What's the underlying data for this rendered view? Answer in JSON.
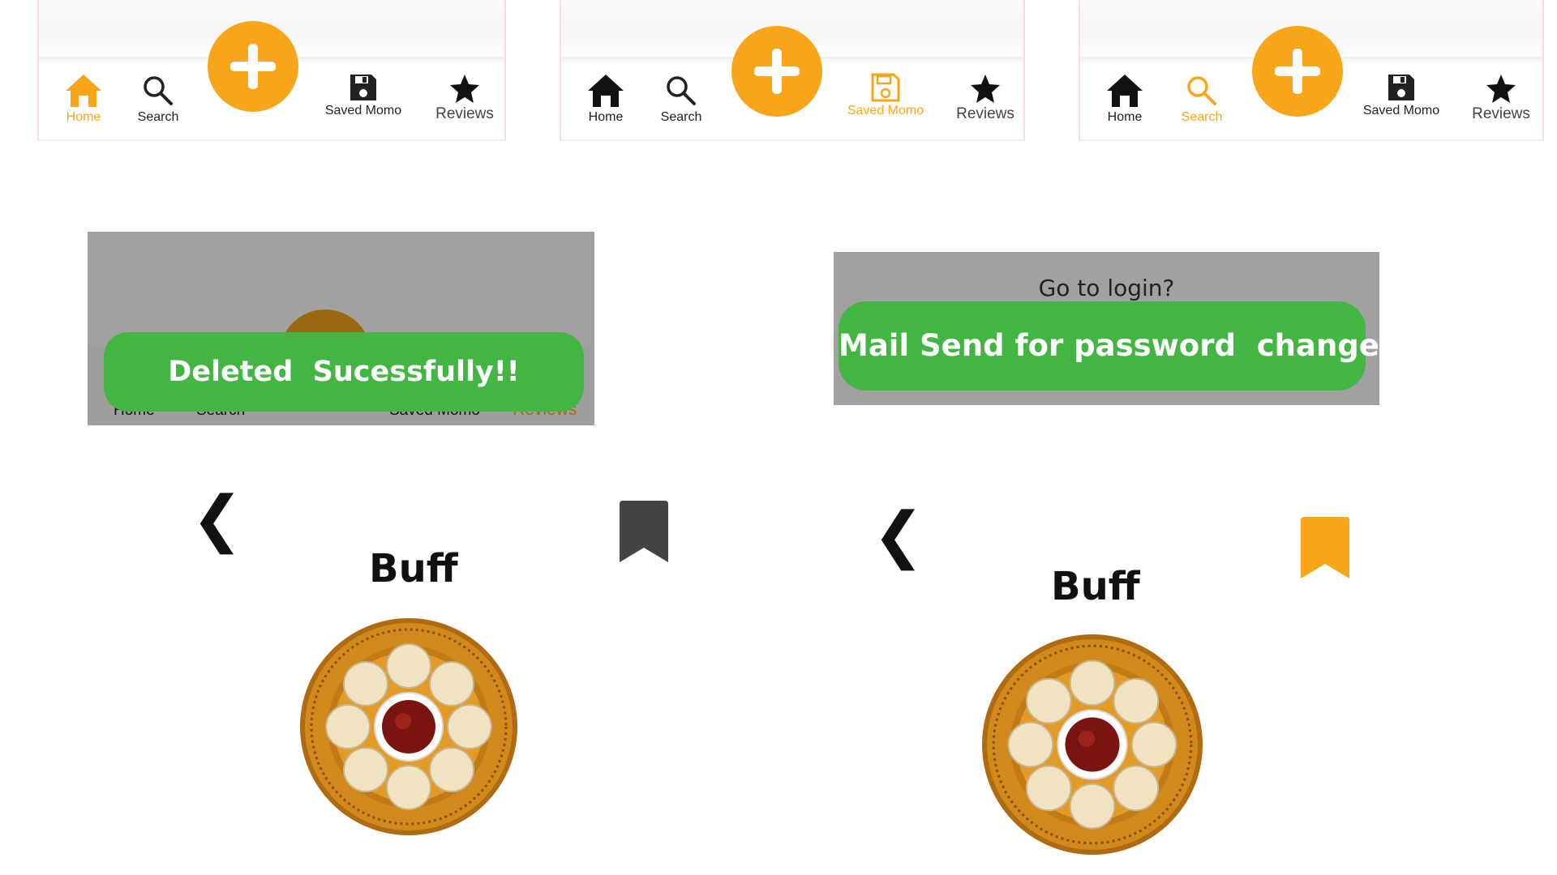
{
  "tab_bars": [
    {
      "active": "home",
      "tabs": [
        {
          "id": "home",
          "label": "Home"
        },
        {
          "id": "search",
          "label": "Search"
        },
        {
          "id": "saved",
          "label": "Saved Momo"
        },
        {
          "id": "reviews",
          "label": "Reviews"
        }
      ]
    },
    {
      "active": "saved",
      "tabs": [
        {
          "id": "home",
          "label": "Home"
        },
        {
          "id": "search",
          "label": "Search"
        },
        {
          "id": "saved",
          "label": "Saved Momo"
        },
        {
          "id": "reviews",
          "label": "Reviews"
        }
      ]
    },
    {
      "active": "search",
      "tabs": [
        {
          "id": "home",
          "label": "Home"
        },
        {
          "id": "search",
          "label": "Search"
        },
        {
          "id": "saved",
          "label": "Saved Momo"
        },
        {
          "id": "reviews",
          "label": "Reviews"
        }
      ]
    }
  ],
  "toasts": {
    "deleted": {
      "message": "Deleted  Sucessfully!!",
      "behind_labels": [
        "Home",
        "Search",
        "Saved Momo",
        "Reviews"
      ]
    },
    "mail": {
      "message": "Mail Send for password  change!",
      "behind_text": "Go to login?"
    }
  },
  "details": [
    {
      "title": "Buff",
      "back_glyph": "❮",
      "bookmark_state": "unsaved"
    },
    {
      "title": "Buff",
      "back_glyph": "❮",
      "bookmark_state": "saved"
    }
  ],
  "colors": {
    "accent": "#f9a51a",
    "toast_green": "#43b543",
    "overlay_gray": "#a1a1a1",
    "bookmark_unsaved": "#444444",
    "bookmark_saved": "#f9a51a"
  }
}
